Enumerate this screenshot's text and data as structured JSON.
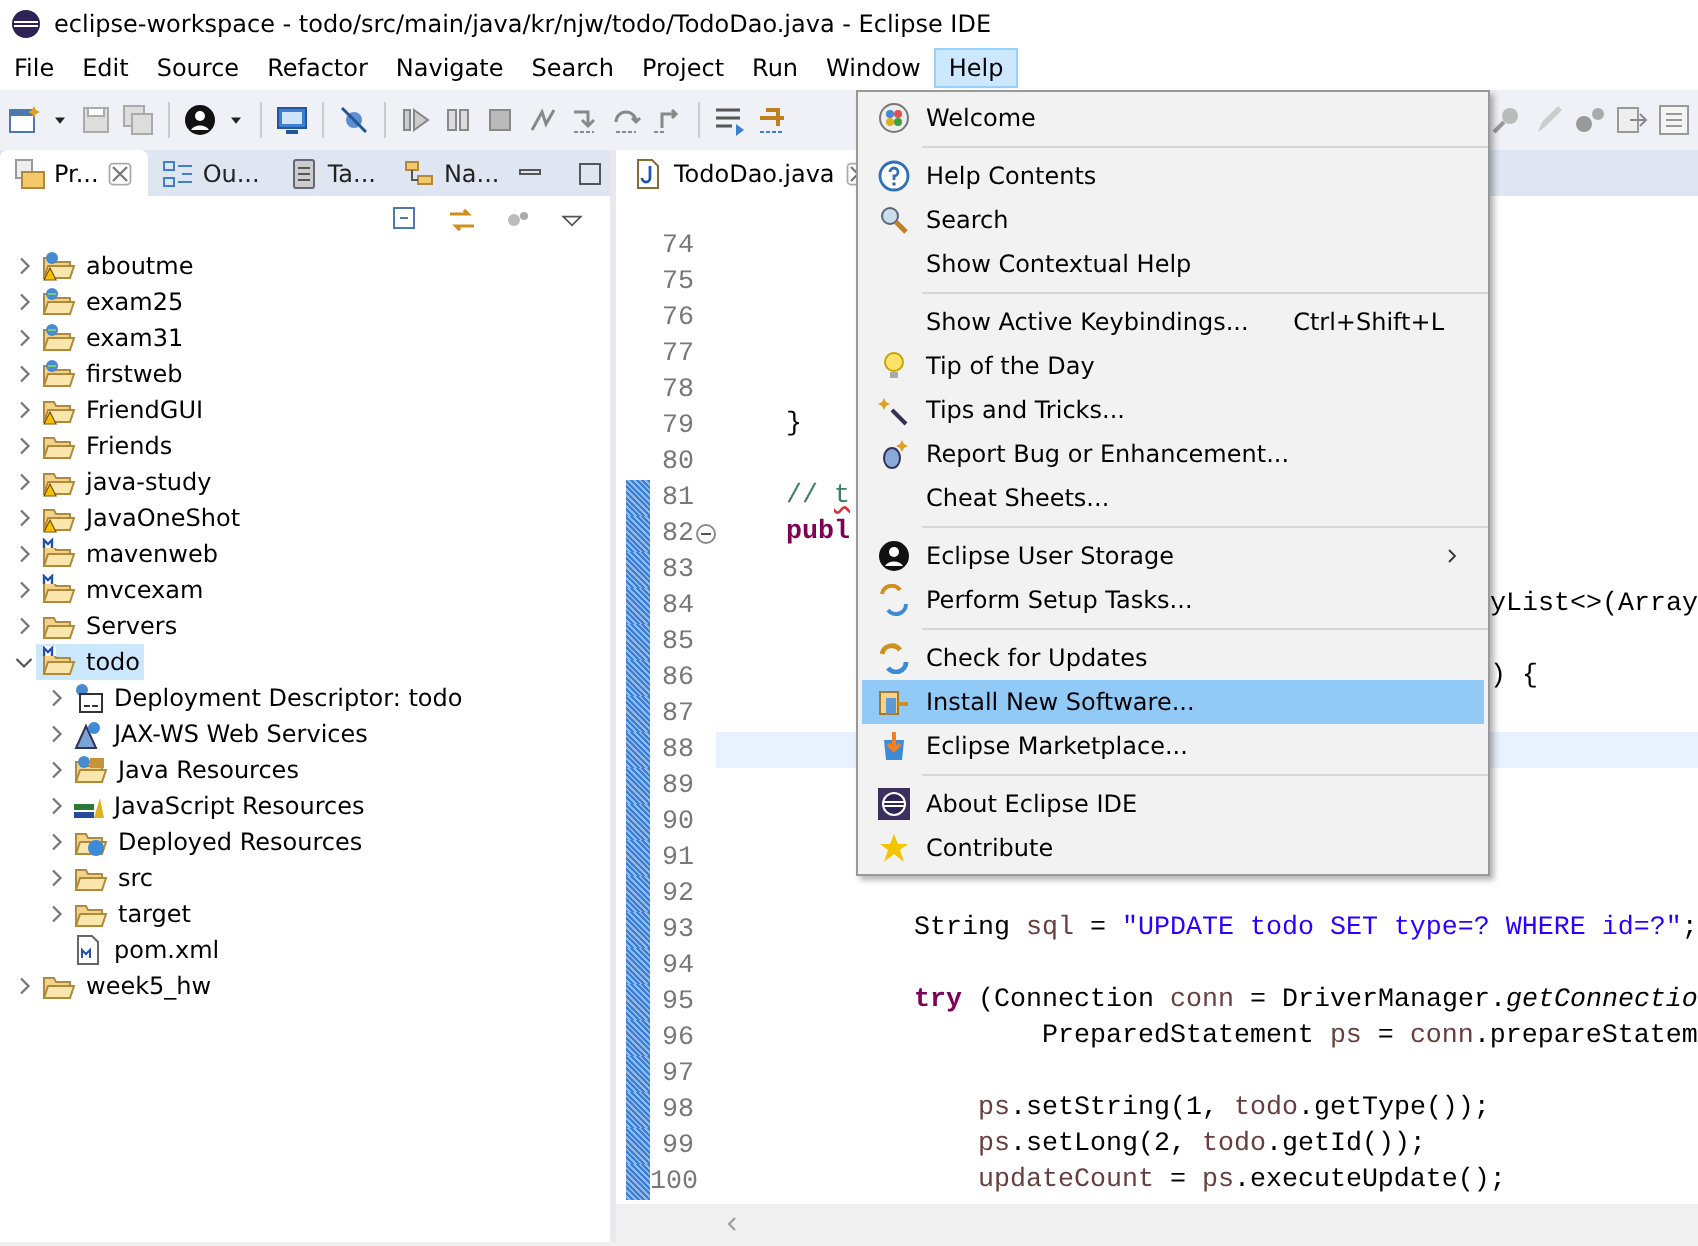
{
  "window": {
    "title": "eclipse-workspace - todo/src/main/java/kr/njw/todo/TodoDao.java - Eclipse IDE"
  },
  "menu_bar": [
    {
      "label": "File",
      "selected": false
    },
    {
      "label": "Edit",
      "selected": false
    },
    {
      "label": "Source",
      "selected": false
    },
    {
      "label": "Refactor",
      "selected": false
    },
    {
      "label": "Navigate",
      "selected": false
    },
    {
      "label": "Search",
      "selected": false
    },
    {
      "label": "Project",
      "selected": false
    },
    {
      "label": "Run",
      "selected": false
    },
    {
      "label": "Window",
      "selected": false
    },
    {
      "label": "Help",
      "selected": true
    }
  ],
  "explorer": {
    "tabs": [
      {
        "label": "Pr...",
        "selected": true
      },
      {
        "label": "Ou...",
        "selected": false
      },
      {
        "label": "Ta...",
        "selected": false
      },
      {
        "label": "Na...",
        "selected": false
      }
    ],
    "tree": [
      {
        "label": "aboutme",
        "kind": "web-project-warning",
        "expanded": false,
        "selected": false
      },
      {
        "label": "exam25",
        "kind": "web-project",
        "expanded": false,
        "selected": false
      },
      {
        "label": "exam31",
        "kind": "web-project",
        "expanded": false,
        "selected": false
      },
      {
        "label": "firstweb",
        "kind": "web-project",
        "expanded": false,
        "selected": false
      },
      {
        "label": "FriendGUI",
        "kind": "project-warning",
        "expanded": false,
        "selected": false
      },
      {
        "label": "Friends",
        "kind": "project",
        "expanded": false,
        "selected": false
      },
      {
        "label": "java-study",
        "kind": "project-warning",
        "expanded": false,
        "selected": false
      },
      {
        "label": "JavaOneShot",
        "kind": "project-warning",
        "expanded": false,
        "selected": false
      },
      {
        "label": "mavenweb",
        "kind": "maven-project",
        "expanded": false,
        "selected": false
      },
      {
        "label": "mvcexam",
        "kind": "maven-project",
        "expanded": false,
        "selected": false
      },
      {
        "label": "Servers",
        "kind": "project",
        "expanded": false,
        "selected": false
      },
      {
        "label": "todo",
        "kind": "maven-project",
        "expanded": true,
        "selected": true,
        "children": [
          {
            "label": "Deployment Descriptor: todo",
            "kind": "descriptor",
            "expanded": false,
            "selected": false
          },
          {
            "label": "JAX-WS Web Services",
            "kind": "web-services",
            "expanded": false,
            "selected": false
          },
          {
            "label": "Java Resources",
            "kind": "java-resources",
            "expanded": false,
            "selected": false
          },
          {
            "label": "JavaScript Resources",
            "kind": "js-resources",
            "expanded": false,
            "selected": false
          },
          {
            "label": "Deployed Resources",
            "kind": "deployed-resources",
            "expanded": false,
            "selected": false
          },
          {
            "label": "src",
            "kind": "folder",
            "expanded": false,
            "selected": false
          },
          {
            "label": "target",
            "kind": "folder",
            "expanded": false,
            "selected": false
          },
          {
            "label": "pom.xml",
            "kind": "xml-file",
            "selected": false
          }
        ]
      },
      {
        "label": "week5_hw",
        "kind": "project",
        "expanded": false,
        "selected": false
      }
    ]
  },
  "editor": {
    "tabs": [
      {
        "label": "TodoDao.java",
        "selected": true
      }
    ],
    "lines": [
      {
        "number": "74",
        "changed": false,
        "collapsible": false,
        "current": false
      },
      {
        "number": "75",
        "changed": false,
        "collapsible": false,
        "current": false
      },
      {
        "number": "76",
        "changed": false,
        "collapsible": false,
        "current": false
      },
      {
        "number": "77",
        "changed": false,
        "collapsible": false,
        "current": false
      },
      {
        "number": "78",
        "changed": false,
        "collapsible": false,
        "current": false
      },
      {
        "number": "79",
        "changed": false,
        "collapsible": false,
        "current": false,
        "code": [
          {
            "t": "    }",
            "kind": "plain"
          }
        ]
      },
      {
        "number": "80",
        "changed": false,
        "collapsible": false,
        "current": false
      },
      {
        "number": "81",
        "changed": true,
        "collapsible": false,
        "current": false,
        "code": [
          {
            "t": "    // ",
            "kind": "comment"
          },
          {
            "t": "t",
            "kind": "comment-typo"
          }
        ]
      },
      {
        "number": "82",
        "changed": true,
        "collapsible": true,
        "current": false,
        "code": [
          {
            "t": "    publ",
            "kind": "keyword"
          }
        ]
      },
      {
        "number": "83",
        "changed": true,
        "collapsible": false,
        "current": false
      },
      {
        "number": "84",
        "changed": true,
        "collapsible": false,
        "current": false,
        "tail": [
          {
            "t": "yList<>(Array",
            "kind": "plain"
          }
        ]
      },
      {
        "number": "85",
        "changed": true,
        "collapsible": false,
        "current": false
      },
      {
        "number": "86",
        "changed": true,
        "collapsible": false,
        "current": false,
        "tail": [
          {
            "t": ") {",
            "kind": "plain"
          }
        ]
      },
      {
        "number": "87",
        "changed": true,
        "collapsible": false,
        "current": false
      },
      {
        "number": "88",
        "changed": true,
        "collapsible": false,
        "current": true
      },
      {
        "number": "89",
        "changed": true,
        "collapsible": false,
        "current": false
      },
      {
        "number": "90",
        "changed": true,
        "collapsible": false,
        "current": false
      },
      {
        "number": "91",
        "changed": true,
        "collapsible": false,
        "current": false
      },
      {
        "number": "92",
        "changed": true,
        "collapsible": false,
        "current": false
      },
      {
        "number": "93",
        "changed": true,
        "collapsible": false,
        "current": false,
        "code": [
          {
            "t": "            String ",
            "kind": "plain"
          },
          {
            "t": "sql",
            "kind": "local"
          },
          {
            "t": " = ",
            "kind": "plain"
          },
          {
            "t": "\"UPDATE todo SET type=? WHERE id=?\"",
            "kind": "string"
          },
          {
            "t": ";",
            "kind": "plain"
          }
        ]
      },
      {
        "number": "94",
        "changed": true,
        "collapsible": false,
        "current": false
      },
      {
        "number": "95",
        "changed": true,
        "collapsible": false,
        "current": false,
        "code": [
          {
            "t": "            try",
            "kind": "keyword"
          },
          {
            "t": " (Connection ",
            "kind": "plain"
          },
          {
            "t": "conn",
            "kind": "local"
          },
          {
            "t": " = DriverManager.",
            "kind": "plain"
          },
          {
            "t": "getConnectio",
            "kind": "static"
          }
        ]
      },
      {
        "number": "96",
        "changed": true,
        "collapsible": false,
        "current": false,
        "code": [
          {
            "t": "                    PreparedStatement ",
            "kind": "plain"
          },
          {
            "t": "ps",
            "kind": "local"
          },
          {
            "t": " = ",
            "kind": "plain"
          },
          {
            "t": "conn",
            "kind": "local"
          },
          {
            "t": ".prepareStatem",
            "kind": "plain"
          }
        ]
      },
      {
        "number": "97",
        "changed": true,
        "collapsible": false,
        "current": false
      },
      {
        "number": "98",
        "changed": true,
        "collapsible": false,
        "current": false,
        "code": [
          {
            "t": "                ps",
            "kind": "local"
          },
          {
            "t": ".setString(1, ",
            "kind": "plain"
          },
          {
            "t": "todo",
            "kind": "local"
          },
          {
            "t": ".getType());",
            "kind": "plain"
          }
        ]
      },
      {
        "number": "99",
        "changed": true,
        "collapsible": false,
        "current": false,
        "code": [
          {
            "t": "                ps",
            "kind": "local"
          },
          {
            "t": ".setLong(2, ",
            "kind": "plain"
          },
          {
            "t": "todo",
            "kind": "local"
          },
          {
            "t": ".getId());",
            "kind": "plain"
          }
        ]
      },
      {
        "number": "100",
        "changed": true,
        "collapsible": false,
        "current": false,
        "code": [
          {
            "t": "                updateCount",
            "kind": "local"
          },
          {
            "t": " = ",
            "kind": "plain"
          },
          {
            "t": "ps",
            "kind": "local"
          },
          {
            "t": ".executeUpdate();",
            "kind": "plain"
          }
        ]
      }
    ]
  },
  "help_menu": {
    "items": [
      {
        "kind": "item",
        "label": "Welcome",
        "submenu": false,
        "selected": false
      },
      {
        "kind": "separator"
      },
      {
        "kind": "item",
        "label": "Help Contents",
        "submenu": false,
        "selected": false
      },
      {
        "kind": "item",
        "label": "Search",
        "submenu": false,
        "selected": false
      },
      {
        "kind": "item",
        "label": "Show Contextual Help",
        "submenu": false,
        "selected": false
      },
      {
        "kind": "separator"
      },
      {
        "kind": "item",
        "label": "Show Active Keybindings...",
        "shortcut": "Ctrl+Shift+L",
        "submenu": false,
        "selected": false
      },
      {
        "kind": "item",
        "label": "Tip of the Day",
        "submenu": false,
        "selected": false
      },
      {
        "kind": "item",
        "label": "Tips and Tricks...",
        "submenu": false,
        "selected": false
      },
      {
        "kind": "item",
        "label": "Report Bug or Enhancement...",
        "submenu": false,
        "selected": false
      },
      {
        "kind": "item",
        "label": "Cheat Sheets...",
        "submenu": false,
        "selected": false
      },
      {
        "kind": "separator"
      },
      {
        "kind": "item",
        "label": "Eclipse User Storage",
        "submenu": true,
        "selected": false
      },
      {
        "kind": "item",
        "label": "Perform Setup Tasks...",
        "submenu": false,
        "selected": false
      },
      {
        "kind": "separator"
      },
      {
        "kind": "item",
        "label": "Check for Updates",
        "submenu": false,
        "selected": false
      },
      {
        "kind": "item",
        "label": "Install New Software...",
        "submenu": false,
        "selected": true
      },
      {
        "kind": "item",
        "label": "Eclipse Marketplace...",
        "submenu": false,
        "selected": false
      },
      {
        "kind": "separator"
      },
      {
        "kind": "item",
        "label": "About Eclipse IDE",
        "submenu": false,
        "selected": false
      },
      {
        "kind": "item",
        "label": "Contribute",
        "submenu": false,
        "selected": false
      }
    ]
  }
}
